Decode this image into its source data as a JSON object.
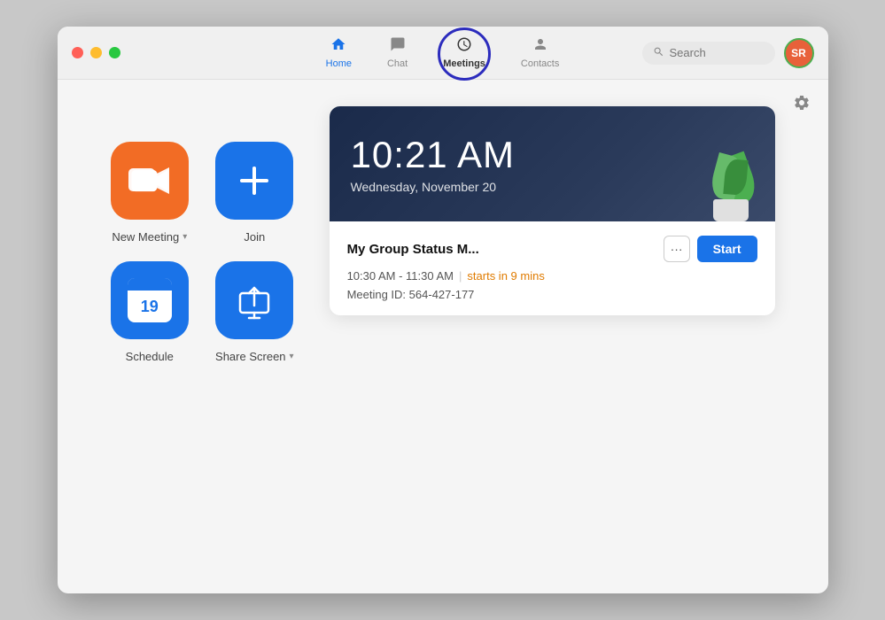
{
  "window": {
    "traffic_lights": [
      "red",
      "yellow",
      "green"
    ]
  },
  "nav": {
    "tabs": [
      {
        "id": "home",
        "label": "Home",
        "active": false,
        "icon": "home"
      },
      {
        "id": "chat",
        "label": "Chat",
        "active": false,
        "icon": "chat"
      },
      {
        "id": "meetings",
        "label": "Meetings",
        "active": true,
        "icon": "clock"
      },
      {
        "id": "contacts",
        "label": "Contacts",
        "active": false,
        "icon": "person"
      }
    ]
  },
  "search": {
    "placeholder": "Search"
  },
  "avatar": {
    "initials": "SR",
    "bg_color": "#e8613a"
  },
  "actions": [
    {
      "id": "new-meeting",
      "label": "New Meeting",
      "has_dropdown": true,
      "type": "orange",
      "icon": "camera"
    },
    {
      "id": "join",
      "label": "Join",
      "has_dropdown": false,
      "type": "blue",
      "icon": "plus"
    },
    {
      "id": "schedule",
      "label": "Schedule",
      "has_dropdown": false,
      "type": "blue",
      "icon": "calendar",
      "calendar_date": "19"
    },
    {
      "id": "share-screen",
      "label": "Share Screen",
      "has_dropdown": true,
      "type": "blue",
      "icon": "share"
    }
  ],
  "meeting_card": {
    "time": "10:21 AM",
    "date": "Wednesday, November 20",
    "title": "My Group Status M...",
    "time_range": "10:30 AM - 11:30 AM",
    "starts_in": "starts in 9 mins",
    "meeting_id_label": "Meeting ID:",
    "meeting_id": "564-427-177",
    "start_button_label": "Start",
    "more_button_label": "···"
  }
}
